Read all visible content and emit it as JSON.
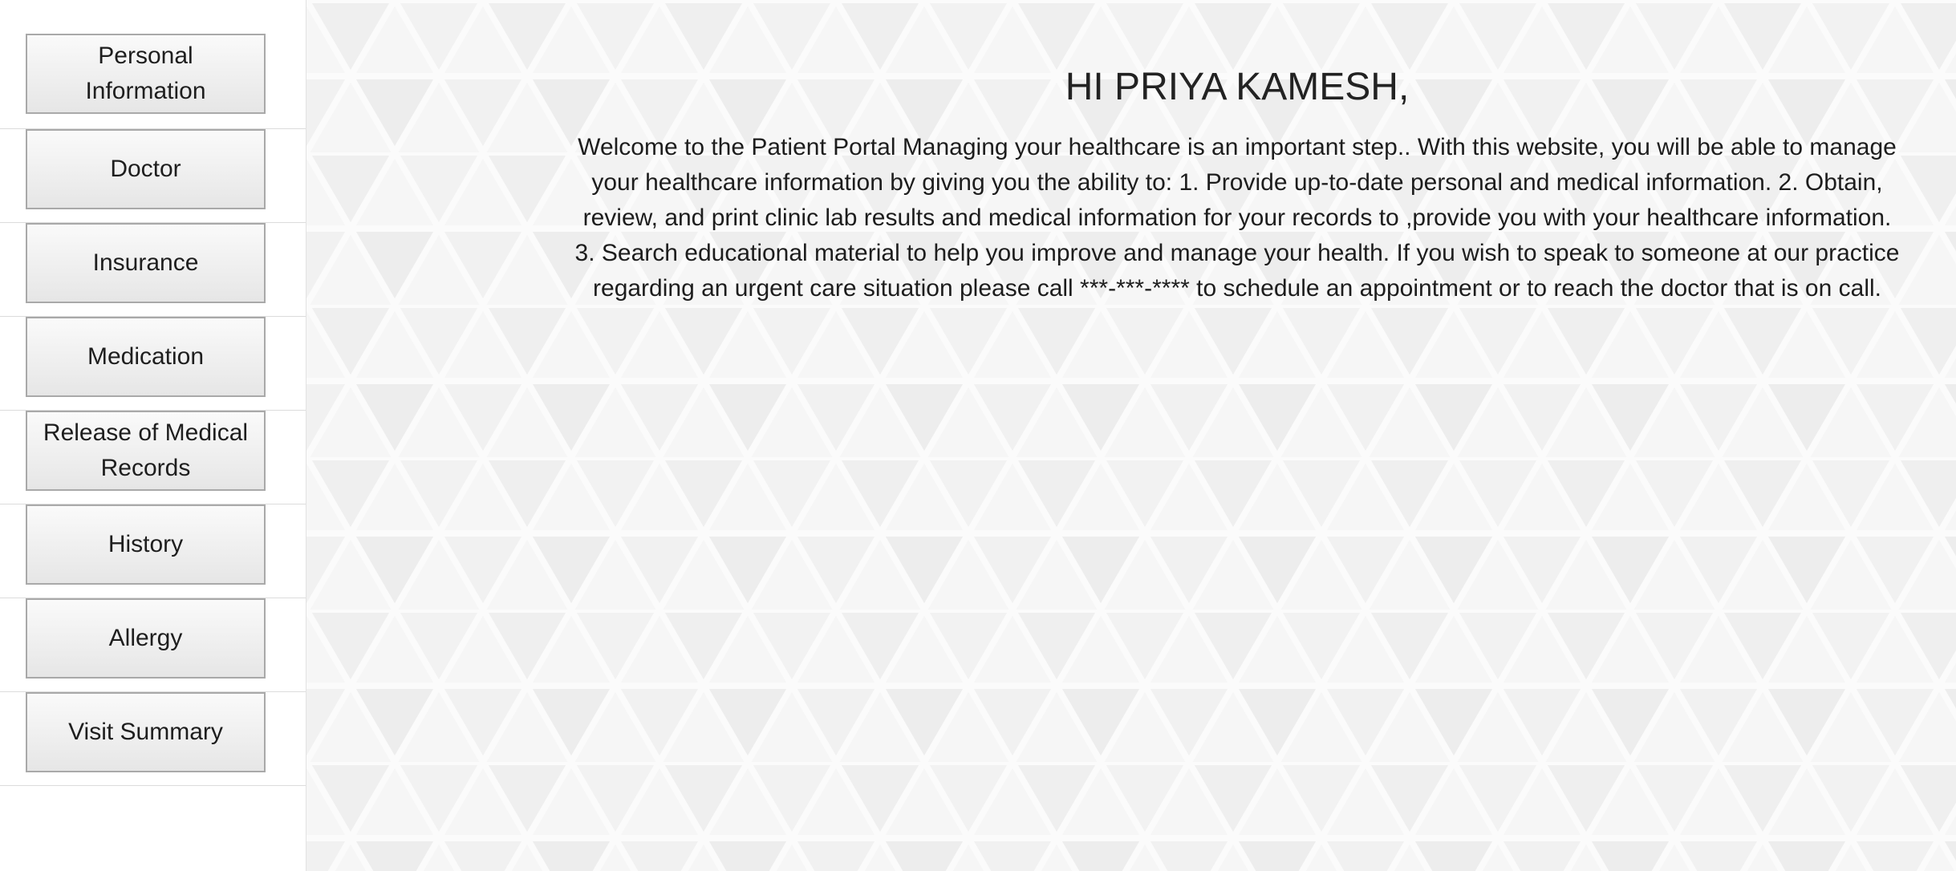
{
  "sidebar": {
    "items": [
      {
        "label": "Personal Information"
      },
      {
        "label": "Doctor"
      },
      {
        "label": "Insurance"
      },
      {
        "label": "Medication"
      },
      {
        "label": "Release of Medical Records"
      },
      {
        "label": "History"
      },
      {
        "label": "Allergy"
      },
      {
        "label": "Visit Summary"
      }
    ]
  },
  "main": {
    "greeting": "HI PRIYA KAMESH,",
    "message": "Welcome to the Patient Portal Managing your healthcare is an important step.. With this website, you will be able to manage your healthcare information by giving you the ability to: 1. Provide up-to-date personal and medical information. 2. Obtain, review, and print clinic lab results and medical information for your records to ,provide you with your healthcare information. 3. Search educational material to help you improve and manage your health. If you wish to speak to someone at our practice regarding an urgent care situation please call ***-***-**** to schedule an appointment or to reach the doctor that is on call."
  },
  "colors": {
    "background": "#f6f6f6",
    "button_border": "#a9a9a9"
  }
}
